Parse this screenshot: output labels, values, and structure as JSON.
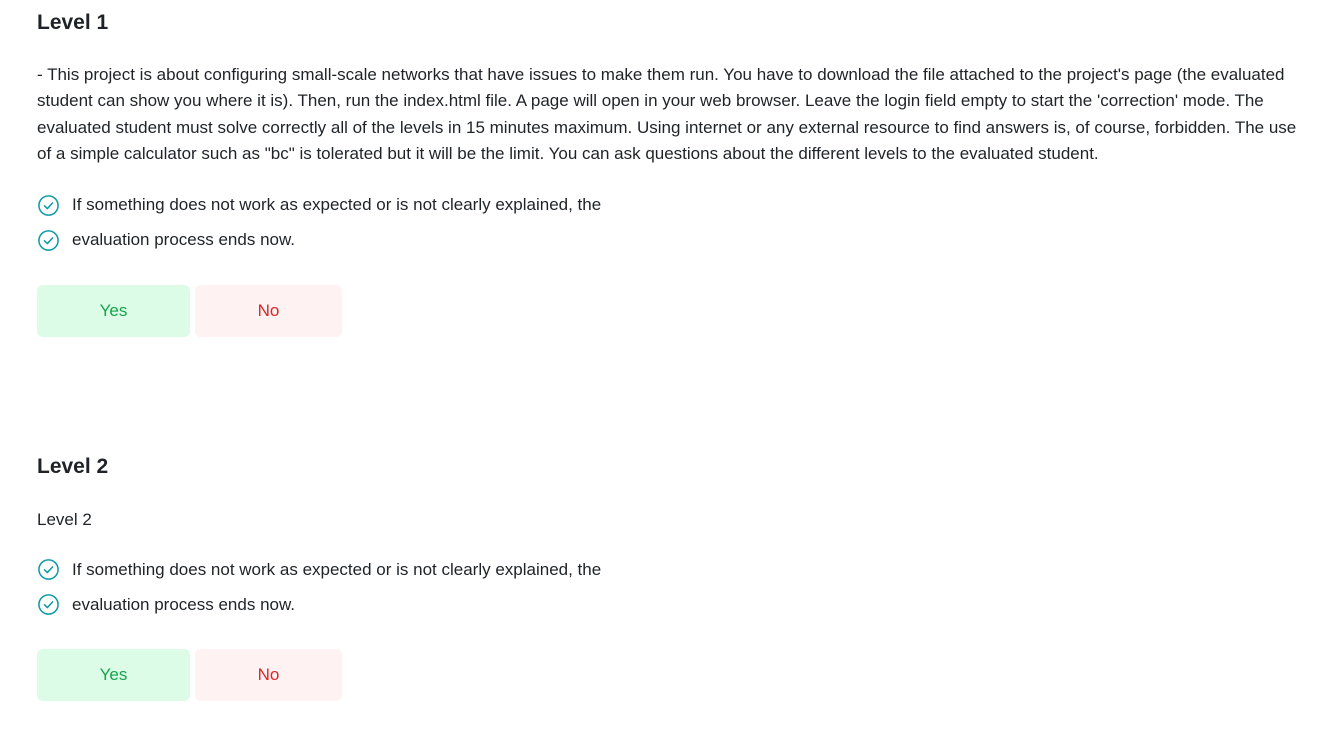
{
  "levels": [
    {
      "title": "Level 1",
      "description": "- This project is about configuring small-scale networks that have issues to make them run. You have to download the file attached to the project's page (the evaluated student can show you where it is). Then, run the index.html file. A page will open in your web browser. Leave the login field empty to start the 'correction' mode. The evaluated student must solve correctly all of the levels in 15 minutes maximum. Using internet or any external resource to find answers is, of course, forbidden. The use of a simple calculator such as \"bc\" is tolerated but it will be the limit. You can ask questions about the different levels to the evaluated student.",
      "checks": [
        "If something does not work as expected or is not clearly explained, the",
        "evaluation process ends now."
      ],
      "yes_label": "Yes",
      "no_label": "No"
    },
    {
      "title": "Level 2",
      "description": "Level 2",
      "checks": [
        "If something does not work as expected or is not clearly explained, the",
        "evaluation process ends now."
      ],
      "yes_label": "Yes",
      "no_label": "No"
    }
  ],
  "icons": {
    "check": "check-circle-icon"
  },
  "colors": {
    "check_icon": "#0f9aa8",
    "yes_bg": "#dcfce7",
    "yes_text": "#16a34a",
    "no_bg": "#fef2f2",
    "no_text": "#dc2626"
  }
}
